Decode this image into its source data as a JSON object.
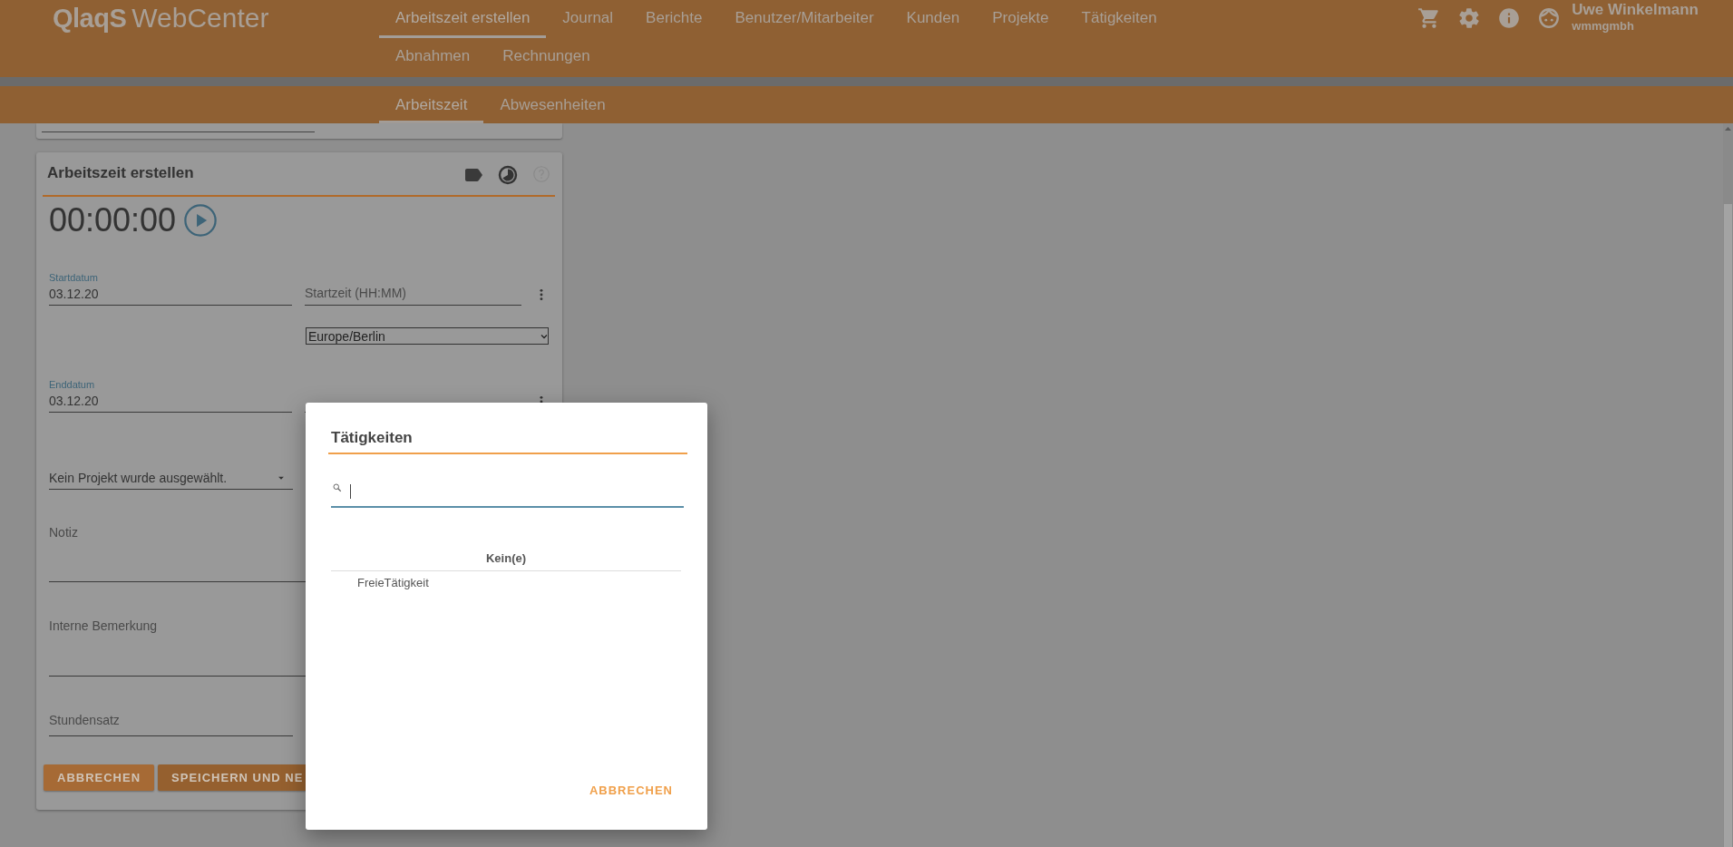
{
  "header": {
    "logo": {
      "brand": "QlaqS",
      "product": "WebCenter"
    },
    "nav_tabs": [
      {
        "label": "Arbeitszeit erstellen",
        "selected": true
      },
      {
        "label": "Journal",
        "selected": false
      },
      {
        "label": "Berichte",
        "selected": false
      },
      {
        "label": "Benutzer/Mitarbeiter",
        "selected": false
      },
      {
        "label": "Kunden",
        "selected": false
      },
      {
        "label": "Projekte",
        "selected": false
      },
      {
        "label": "Tätigkeiten",
        "selected": false
      },
      {
        "label": "Abnahmen",
        "selected": false
      },
      {
        "label": "Rechnungen",
        "selected": false
      }
    ],
    "user": {
      "name": "Uwe Winkelmann",
      "company": "wmmgmbh"
    }
  },
  "sub_tabs": [
    {
      "label": "Arbeitszeit",
      "selected": true
    },
    {
      "label": "Abwesenheiten",
      "selected": false
    }
  ],
  "form_card": {
    "title": "Arbeitszeit erstellen",
    "timer": "00:00:00",
    "start": {
      "date_label": "Startdatum",
      "date_value": "03.12.20",
      "time_placeholder": "Startzeit (HH:MM)",
      "timezone": "Europe/Berlin"
    },
    "end": {
      "date_label": "Enddatum",
      "date_value": "03.12.20"
    },
    "project": "Kein Projekt wurde ausgewählt.",
    "note_placeholder": "Notiz",
    "internal_note_placeholder": "Interne Bemerkung",
    "rate_placeholder": "Stundensatz",
    "buttons": [
      "ABBRECHEN",
      "SPEICHERN UND NE"
    ]
  },
  "dialog": {
    "title": "Tätigkeiten",
    "table": {
      "columns": [
        "Kein(e)"
      ],
      "rows": [
        [
          "FreieTätigkeit"
        ]
      ]
    },
    "buttons": [
      "ABBRECHEN"
    ]
  }
}
